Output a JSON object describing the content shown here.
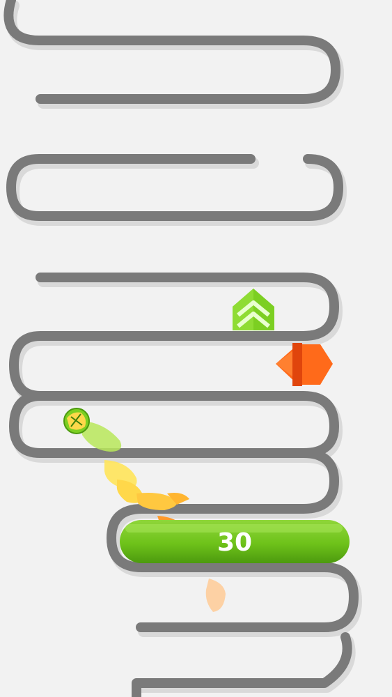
{
  "game": {
    "score_pill_value": "30",
    "colors": {
      "background": "#f2f2f2",
      "track": "#7a7a7a",
      "track_shadow": "#d9d9d9",
      "pill_fill": "#6ec21a",
      "pill_light": "#8fd63a",
      "pill_dark": "#4c9a0e",
      "booster": "#7ccf22",
      "spinner": "#ff6a1a",
      "ball": "#7ccf22",
      "trail_yellow": "#ffd84a",
      "trail_orange": "#ff9a2a"
    },
    "icons": {
      "booster": "chevron-up-icon",
      "spinner": "spinner-blade-icon",
      "ball": "ball-icon"
    }
  }
}
